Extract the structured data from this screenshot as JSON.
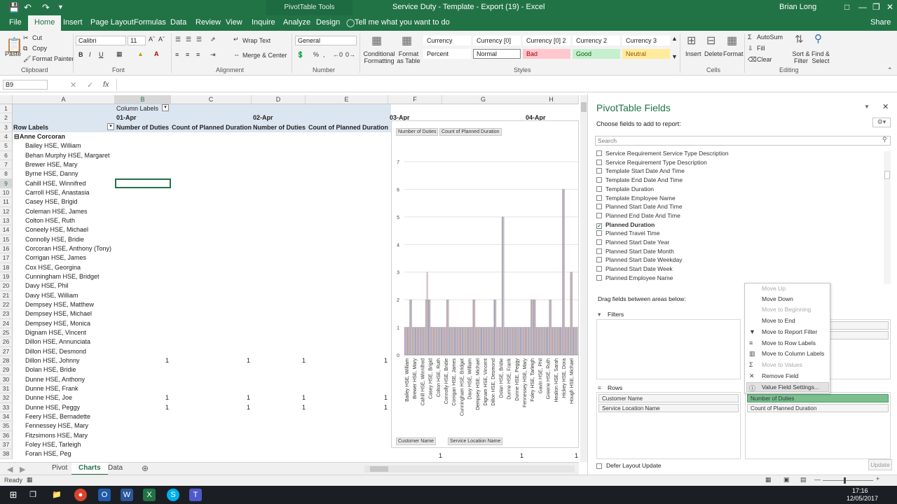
{
  "titlebar": {
    "context_tab": "PivotTable Tools",
    "document": "Service Duty - Template - Export (19)  -  Excel",
    "user": "Brian Long"
  },
  "tabs": [
    "File",
    "Home",
    "Insert",
    "Page Layout",
    "Formulas",
    "Data",
    "Review",
    "View",
    "Inquire",
    "Analyze",
    "Design"
  ],
  "tellme": "Tell me what you want to do",
  "share": "Share",
  "ribbon": {
    "clipboard": {
      "paste": "Paste",
      "cut": "Cut",
      "copy": "Copy",
      "painter": "Format Painter",
      "label": "Clipboard"
    },
    "font": {
      "name": "Calibri",
      "size": "11",
      "label": "Font"
    },
    "alignment": {
      "wrap": "Wrap Text",
      "merge": "Merge & Center",
      "label": "Alignment"
    },
    "number": {
      "format": "General",
      "label": "Number"
    },
    "styles": {
      "cond": "Conditional Formatting",
      "table": "Format as Table",
      "label": "Styles",
      "boxes": [
        {
          "t": "Currency",
          "bg": "#ffffff",
          "fg": "#222222"
        },
        {
          "t": "Currency [0]",
          "bg": "#ffffff",
          "fg": "#222222"
        },
        {
          "t": "Currency [0] 2",
          "bg": "#ffffff",
          "fg": "#222222"
        },
        {
          "t": "Currency 2",
          "bg": "#ffffff",
          "fg": "#222222"
        },
        {
          "t": "Currency 3",
          "bg": "#ffffff",
          "fg": "#222222"
        },
        {
          "t": "Percent",
          "bg": "#ffffff",
          "fg": "#222222"
        },
        {
          "t": "Normal",
          "bg": "#ffffff",
          "fg": "#222222"
        },
        {
          "t": "Bad",
          "bg": "#ffc7ce",
          "fg": "#9c0006"
        },
        {
          "t": "Good",
          "bg": "#c6efce",
          "fg": "#006100"
        },
        {
          "t": "Neutral",
          "bg": "#ffeb9c",
          "fg": "#9c5700"
        }
      ]
    },
    "cells": {
      "insert": "Insert",
      "delete": "Delete",
      "format": "Format",
      "label": "Cells"
    },
    "editing": {
      "autosum": "AutoSum",
      "fill": "Fill",
      "clear": "Clear",
      "sort": "Sort & Filter",
      "find": "Find & Select",
      "label": "Editing"
    }
  },
  "formula": {
    "namebox": "B9",
    "fx": "fx"
  },
  "columns": [
    "A",
    "B",
    "C",
    "D",
    "E",
    "F",
    "G",
    "H"
  ],
  "pivot": {
    "column_labels": "Column Labels",
    "dates": [
      "01-Apr",
      "02-Apr",
      "03-Apr",
      "04-Apr"
    ],
    "row_labels": "Row Labels",
    "measure1": "Number of Duties",
    "measure2": "Count of Planned Duration",
    "group": "Anne Corcoran",
    "names": [
      "Bailey HSE, William",
      "Behan Murphy HSE, Margaret",
      "Brewer HSE, Mary",
      "Byrne HSE, Danny",
      "Cahill HSE, Winnifred",
      "Carroll HSE, Anastasia",
      "Casey HSE, Brigid",
      "Coleman HSE, James",
      "Colton HSE, Ruth",
      "Coneely HSE, Michael",
      "Connolly HSE, Bridie",
      "Corcoran HSE, Anthony (Tony)",
      "Corrigan HSE, James",
      "Cox HSE, Georgina",
      "Cunningham HSE, Bridget",
      "Davy HSE, Phil",
      "Davy HSE, William",
      "Dempsey HSE, Matthew",
      "Dempsey HSE, Michael",
      "Dempsey HSE, Monica",
      "Dignam HSE, Vincent",
      "Dillon HSE, Annunciata",
      "Dillon HSE, Desmond",
      "Dillon HSE, Johnny",
      "Dolan HSE, Bridie",
      "Dunne HSE, Anthony",
      "Dunne HSE, Frank",
      "Dunne HSE, Joe",
      "Dunne HSE, Peggy",
      "Feery HSE, Bernadette",
      "Fennessey HSE, Mary",
      "Fitzsimons HSE, Mary",
      "Foley HSE, Tarleigh",
      "Foran HSE, Peg"
    ],
    "value_rows": [
      {
        "row": 28,
        "v": "1"
      },
      {
        "row": 32,
        "v": "1"
      },
      {
        "row": 33,
        "v": "1"
      }
    ],
    "row_numbers": [
      "1",
      "2",
      "3",
      "4",
      "5",
      "6",
      "7",
      "8",
      "9",
      "10",
      "11",
      "12",
      "13",
      "14",
      "15",
      "16",
      "17",
      "18",
      "19",
      "20",
      "21",
      "22",
      "23",
      "24",
      "25",
      "26",
      "27",
      "28",
      "29",
      "30",
      "31",
      "32",
      "33",
      "34",
      "35",
      "36",
      "37",
      "38"
    ],
    "bottom_values": [
      "1",
      "1",
      "1"
    ]
  },
  "chart": {
    "legend": [
      "Number of Duties",
      "Count of Planned Duration"
    ],
    "axis_buttons": [
      "Customer Name",
      "Service Location Name"
    ],
    "xlabels": [
      "Bailey HSE, William",
      "Brewer HSE, Mary",
      "Cahill HSE, Winnifred",
      "Casey HSE, Brigid",
      "Colton HSE, Ruth",
      "Connolly HSE, Bridie",
      "Corrigan HSE, James",
      "Cunningham HSE, Bridget",
      "Davy HSE, William",
      "Dempsey HSE, Michael",
      "Dignam HSE, Vincent",
      "Dillon HSE, Desmond",
      "Dolan HSE, Bridie",
      "Dunne HSE, Frank",
      "Dunne HSE, Peggy",
      "Fennessey HSE, Mary",
      "Foley HSE, Tarleigh",
      "Gavin HSE, Phil",
      "Greene HSE, Ruth",
      "Healion HSE, Sarah",
      "Hickey HSE, Dora",
      "Hough HSE, Michael"
    ]
  },
  "chart_data": {
    "type": "bar",
    "ylim": [
      0,
      7
    ],
    "yticks": [
      0,
      1,
      2,
      3,
      4,
      5,
      6,
      7
    ],
    "series": [
      {
        "name": "Number of Duties",
        "values": [
          1,
          1,
          2,
          1,
          1,
          1,
          1,
          1,
          2,
          2,
          1,
          1,
          1,
          1,
          1,
          1,
          2,
          1,
          1,
          1,
          1,
          1,
          1,
          1,
          1,
          1,
          2,
          1,
          1,
          1,
          1,
          1,
          1,
          1,
          2,
          1,
          1,
          5,
          1,
          1,
          1,
          1,
          1,
          1,
          1,
          1,
          1,
          1,
          2,
          2,
          1,
          1,
          1,
          1,
          1,
          2,
          1,
          1,
          1,
          1,
          6,
          1,
          1,
          3,
          1,
          1
        ]
      },
      {
        "name": "Count of Planned Duration",
        "values": [
          1,
          1,
          2,
          1,
          1,
          1,
          1,
          1,
          3,
          2,
          1,
          1,
          1,
          1,
          1,
          1,
          2,
          1,
          1,
          1,
          1,
          1,
          1,
          1,
          1,
          1,
          2,
          1,
          1,
          1,
          1,
          1,
          1,
          1,
          2,
          1,
          1,
          5,
          1,
          1,
          1,
          1,
          1,
          1,
          1,
          1,
          1,
          1,
          2,
          2,
          1,
          1,
          1,
          1,
          1,
          2,
          1,
          1,
          1,
          1,
          6,
          1,
          1,
          3,
          1,
          1
        ]
      }
    ]
  },
  "panel": {
    "title": "PivotTable Fields",
    "choose": "Choose fields to add to report:",
    "search": "Search",
    "fields": [
      {
        "t": "Service Requirement Service Type Description",
        "c": false
      },
      {
        "t": "Service Requirement Type Description",
        "c": false
      },
      {
        "t": "Template Start Date And Time",
        "c": false
      },
      {
        "t": "Template End Date And Time",
        "c": false
      },
      {
        "t": "Template Duration",
        "c": false
      },
      {
        "t": "Template Employee Name",
        "c": false
      },
      {
        "t": "Planned Start Date And Time",
        "c": false
      },
      {
        "t": "Planned End Date And Time",
        "c": false
      },
      {
        "t": "Planned Duration",
        "c": true
      },
      {
        "t": "Planned Travel Time",
        "c": false
      },
      {
        "t": "Planned Start Date Year",
        "c": false
      },
      {
        "t": "Planned Start Date Month",
        "c": false
      },
      {
        "t": "Planned Start Date Weekday",
        "c": false
      },
      {
        "t": "Planned Start Date Week",
        "c": false
      },
      {
        "t": "Planned Employee Name",
        "c": false
      }
    ],
    "drag": "Drag fields between areas below:",
    "filters": "Filters",
    "rows": "Rows",
    "row_items": [
      "Customer Name",
      "Service Location Name"
    ],
    "value_items": [
      "Number of Duties",
      "Count of Planned Duration"
    ],
    "defer": "Defer Layout Update",
    "update": "Update"
  },
  "menu": [
    {
      "t": "Move Up",
      "d": true
    },
    {
      "t": "Move Down",
      "d": false
    },
    {
      "t": "Move to Beginning",
      "d": true
    },
    {
      "t": "Move to End",
      "d": false
    },
    {
      "t": "Move to Report Filter",
      "d": false
    },
    {
      "t": "Move to Row Labels",
      "d": false
    },
    {
      "t": "Move to Column Labels",
      "d": false
    },
    {
      "t": "Move to Values",
      "d": true
    },
    {
      "t": "Remove Field",
      "d": false
    },
    {
      "t": "Value Field Settings...",
      "d": false
    }
  ],
  "sheets": [
    "Pivot",
    "Charts",
    "Data"
  ],
  "status": {
    "ready": "Ready",
    "time": "17:16",
    "date": "12/05/2017"
  },
  "colors": {
    "excel_green": "#217346",
    "pivot_header": "#dce6f1",
    "bar": "#b9b2c8"
  }
}
